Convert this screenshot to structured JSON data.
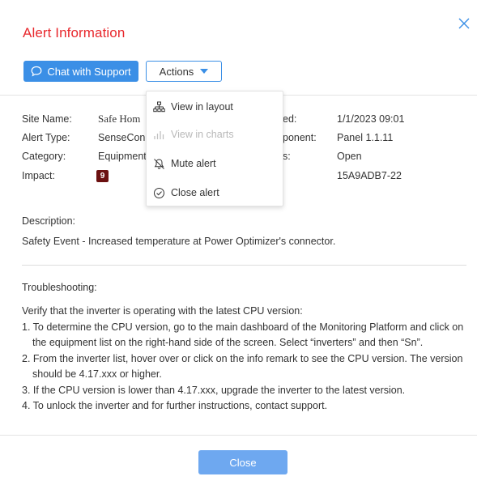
{
  "dialog": {
    "title": "Alert Information",
    "close_glyph": "×"
  },
  "toolbar": {
    "chat_label": "Chat with Support",
    "actions_label": "Actions"
  },
  "details": {
    "site_name_label": "Site Name:",
    "site_name_value": "Safe Hom",
    "alert_type_label": "Alert Type:",
    "alert_type_value": "SenseConn",
    "category_label": "Category:",
    "category_value": "Equipment",
    "impact_label": "Impact:",
    "impact_value": "9",
    "col2_row1_label": "ed:",
    "col2_row1_value": "1/1/2023 09:01",
    "col2_row2_label": "ponent:",
    "col2_row2_value": "Panel 1.1.11",
    "col2_row3_label": "s:",
    "col2_row3_value": "Open",
    "col2_row4_value": "15A9ADB7-22"
  },
  "actions_menu": {
    "items": [
      {
        "label": "View in layout",
        "icon": "layout-icon",
        "enabled": true
      },
      {
        "label": "View in charts",
        "icon": "chart-icon",
        "enabled": false
      },
      {
        "label": "Mute alert",
        "icon": "bell-muted-icon",
        "enabled": true
      },
      {
        "label": "Close alert",
        "icon": "check-circle-icon",
        "enabled": true
      }
    ]
  },
  "description": {
    "title": "Description:",
    "text": "Safety Event - Increased temperature at Power Optimizer's connector."
  },
  "troubleshooting": {
    "title": "Troubleshooting:",
    "intro": "Verify that the inverter is operating with the latest CPU version:",
    "steps": [
      "1. To determine the CPU version, go to the main dashboard of the Monitoring Platform and click on the equipment list on the right-hand side of the screen. Select “inverters” and then “Sn”.",
      "2. From the inverter list, hover over or click on the info remark to see the CPU version. The version should be 4.17.xxx or higher.",
      "3. If the CPU version is lower than 4.17.xxx, upgrade the inverter to the latest version.",
      "4. To unlock the inverter and for further instructions, contact support."
    ]
  },
  "footer": {
    "close_label": "Close"
  },
  "colors": {
    "title_red": "#e8282d",
    "primary_blue": "#3b8fe6",
    "close_button_blue": "#6ea8f0",
    "impact_badge": "#6b1010"
  }
}
